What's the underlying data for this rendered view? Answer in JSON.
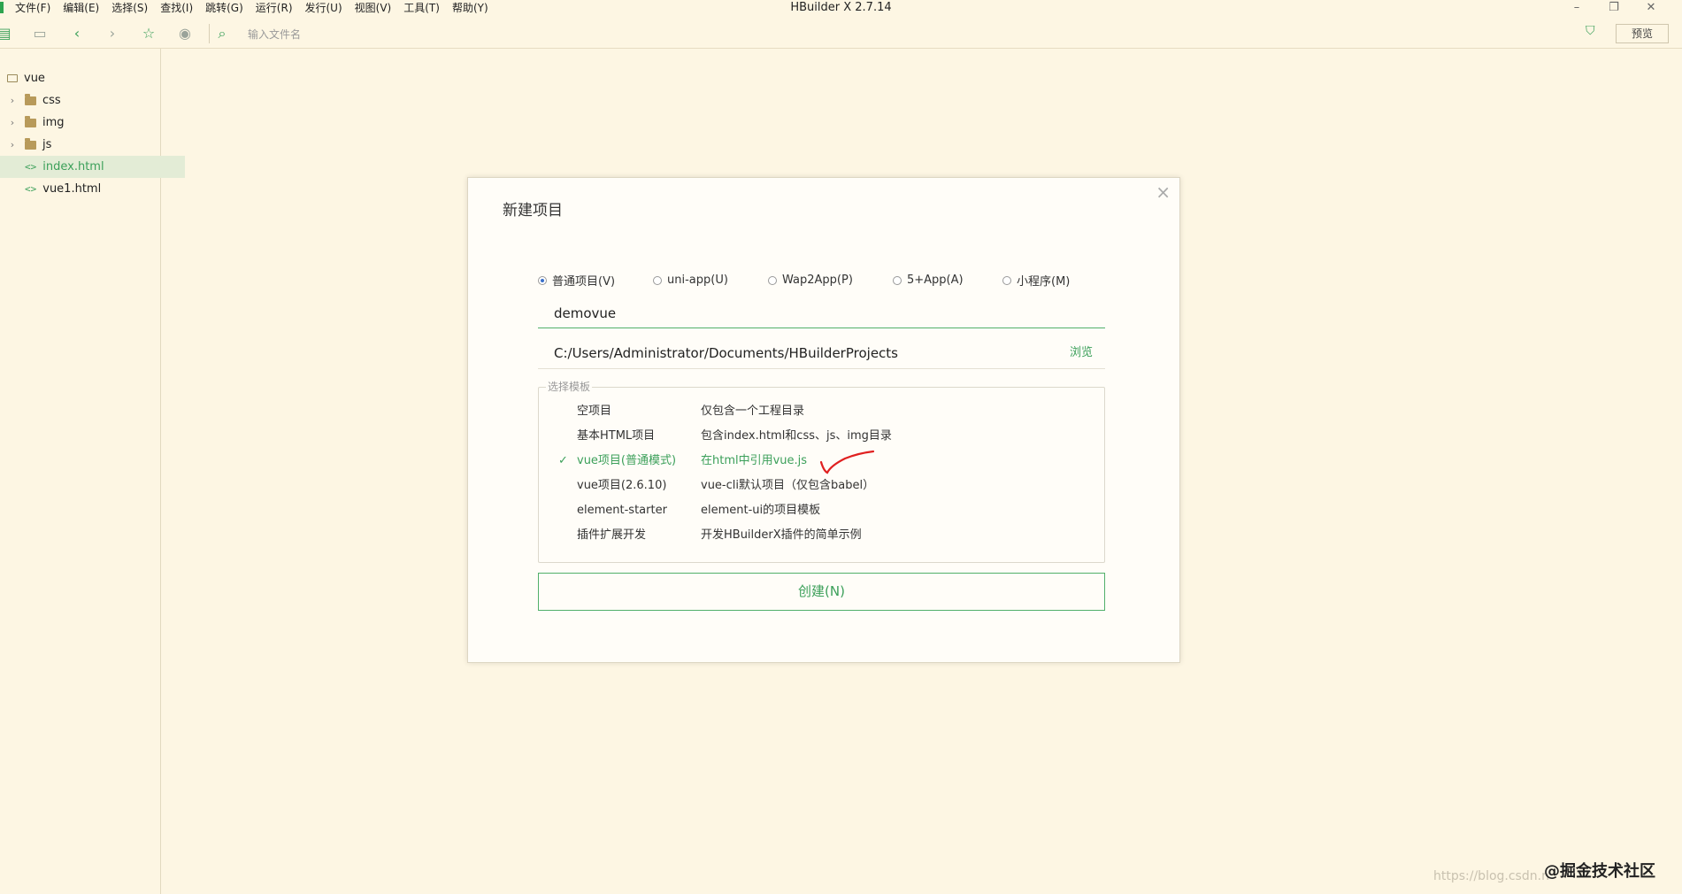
{
  "window": {
    "title": "HBuilder X 2.7.14",
    "controls": [
      "–",
      "❐",
      "✕"
    ]
  },
  "menu": [
    "文件(F)",
    "编辑(E)",
    "选择(S)",
    "查找(I)",
    "跳转(G)",
    "运行(R)",
    "发行(U)",
    "视图(V)",
    "工具(T)",
    "帮助(Y)"
  ],
  "toolbar": {
    "search_placeholder": "输入文件名",
    "preview_label": "预览"
  },
  "sidebar": {
    "project": "vue",
    "folders": [
      "css",
      "img",
      "js"
    ],
    "files": [
      "index.html",
      "vue1.html"
    ],
    "active_file": "index.html"
  },
  "dialog": {
    "title": "新建项目",
    "project_types": [
      {
        "label": "普通项目(V)",
        "checked": true
      },
      {
        "label": "uni-app(U)",
        "checked": false
      },
      {
        "label": "Wap2App(P)",
        "checked": false
      },
      {
        "label": "5+App(A)",
        "checked": false
      },
      {
        "label": "小程序(M)",
        "checked": false
      }
    ],
    "project_name": "demovue",
    "path": "C:/Users/Administrator/Documents/HBuilderProjects",
    "browse_label": "浏览",
    "template_legend": "选择模板",
    "templates": [
      {
        "name": "空项目",
        "desc": "仅包含一个工程目录",
        "selected": false
      },
      {
        "name": "基本HTML项目",
        "desc": "包含index.html和css、js、img目录",
        "selected": false
      },
      {
        "name": "vue项目(普通模式)",
        "desc": "在html中引用vue.js",
        "selected": true
      },
      {
        "name": "vue项目(2.6.10)",
        "desc": "vue-cli默认项目（仅包含babel）",
        "selected": false
      },
      {
        "name": "element-starter",
        "desc": "element-ui的项目模板",
        "selected": false
      },
      {
        "name": "插件扩展开发",
        "desc": "开发HBuilderX插件的简单示例",
        "selected": false
      }
    ],
    "create_label": "创建(N)"
  },
  "footer": {
    "watermark": "https://blog.csdn.n",
    "brand": "@掘金技术社区"
  },
  "colors": {
    "background": "#fdf6e3",
    "accent": "#3ca05a",
    "annotation": "#e02020"
  }
}
